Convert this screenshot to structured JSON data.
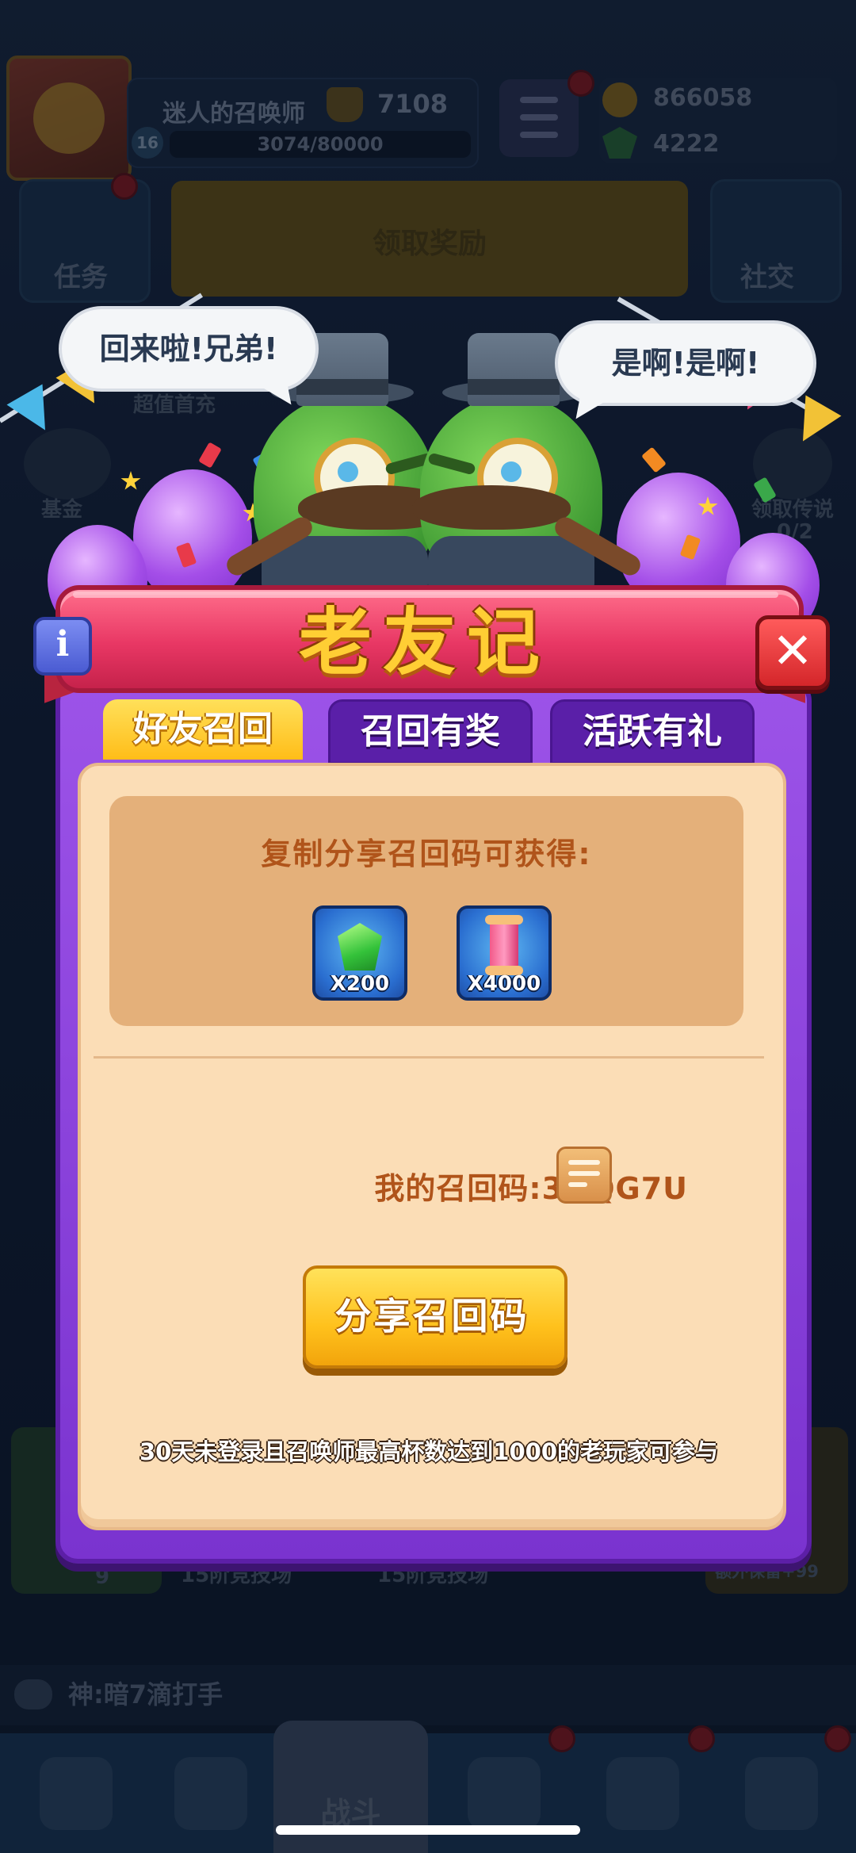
{
  "hud": {
    "player_name": "迷人的召唤师",
    "trophies": "7108",
    "level": "16",
    "xp": "3074/80000",
    "gold": "866058",
    "gems": "4222",
    "left_button": "任务",
    "right_button": "社交",
    "claim_button": "领取奖励"
  },
  "background_labels": {
    "first_purchase": "超值首充",
    "fund": "基金",
    "legend": "领取传说",
    "legend_progress": "0/2",
    "arena_a": "15阶竞技场",
    "arena_b": "15阶竞技场",
    "gem_count": "9",
    "extra": "额外保留+99"
  },
  "chat": {
    "message": "神:暗7滴打手"
  },
  "nav": {
    "battle": "战斗"
  },
  "speech": {
    "left": "回来啦!兄弟!",
    "right": "是啊!是啊!"
  },
  "modal": {
    "title": "老友记",
    "info_glyph": "i",
    "close_glyph": "✕",
    "tabs": [
      "好友召回",
      "召回有奖",
      "活跃有礼"
    ],
    "active_tab": 0,
    "reward_title": "复制分享召回码可获得:",
    "rewards": [
      {
        "icon": "gem-icon",
        "qty": "X200"
      },
      {
        "icon": "scroll-icon",
        "qty": "X4000"
      }
    ],
    "code_label": "我的召回码:",
    "code_value": "3GQG7U",
    "share_button": "分享召回码",
    "note": "30天未登录且召唤师最高杯数达到1000的老玩家可参与"
  },
  "colors": {
    "modal_purple": "#8a45dc",
    "banner_pink": "#e83764",
    "title_gold": "#ffce34",
    "content_cream": "#fbddb6",
    "reward_tan": "#e4b07a",
    "button_yellow": "#ffc11c",
    "text_brown": "#b0541a"
  }
}
